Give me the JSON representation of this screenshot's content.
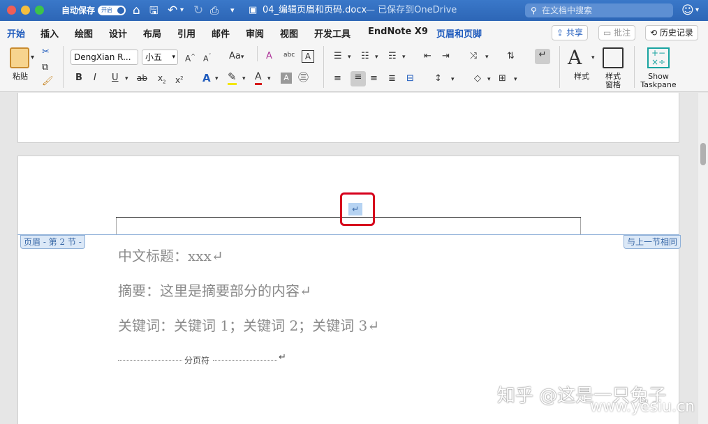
{
  "titlebar": {
    "autosave_label": "自动保存",
    "autosave_toggle": "开启",
    "doc_title": "04_编辑页眉和页码.docx",
    "save_status": " — 已保存到OneDrive",
    "search_placeholder": "在文档中搜索"
  },
  "tabs": [
    "开始",
    "插入",
    "绘图",
    "设计",
    "布局",
    "引用",
    "邮件",
    "审阅",
    "视图",
    "开发工具",
    "EndNote X9",
    "页眉和页脚"
  ],
  "tab_buttons": {
    "share": "共享",
    "comment": "批注",
    "history": "历史记录"
  },
  "ribbon": {
    "paste_label": "粘贴",
    "font_name": "DengXian R...",
    "font_size": "小五",
    "bold": "B",
    "italic": "I",
    "underline": "U",
    "strike": "ab",
    "subscript": "x",
    "superscript": "x",
    "styles_label": "样式",
    "styles_pane_label": "样式\n窗格",
    "show_taskpane": "Show\nTaskpane",
    "grow_font": "A",
    "shrink_font": "A",
    "change_case": "Aa",
    "clear_format": "A",
    "phonetic": "abc",
    "char_border": "A"
  },
  "document": {
    "header_left_tag": "页眉 - 第 2 节 -",
    "header_right_tag": "与上一节相同",
    "header_paragraph_mark": "↵",
    "lines": [
      "中文标题：xxx↵",
      "摘要：这里是摘要部分的内容↵",
      "关键词：关键词 1；关键词 2；关键词 3↵"
    ],
    "page_break_label": "分页符",
    "page_break_mark": "↵"
  },
  "watermark": {
    "text": "知乎 @这是一只兔子",
    "url": "www.yesiu.cn"
  },
  "colors": {
    "title_bar": "#2d66b6",
    "accent": "#1f5bbd",
    "highlight": "#d6001c"
  }
}
